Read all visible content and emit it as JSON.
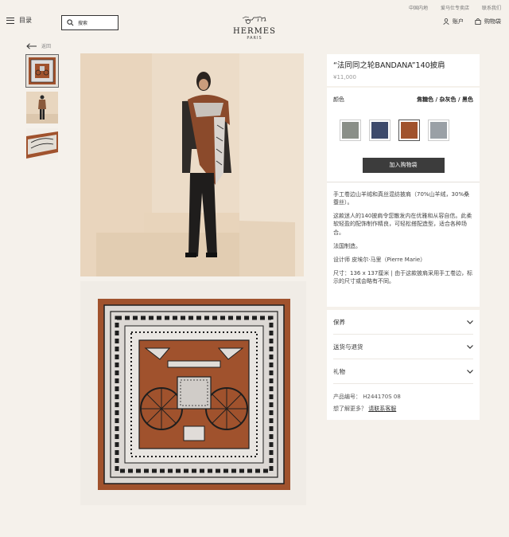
{
  "header": {
    "toplinks": [
      "中国内地",
      "爱马仕专卖店",
      "联系我们"
    ],
    "menu_label": "目录",
    "search_placeholder": "搜索",
    "brand": "HERMES",
    "city": "PARIS",
    "account_label": "账户",
    "cart_label": "购物袋"
  },
  "nav": {
    "back_label": "返回"
  },
  "product": {
    "title": "“法同同之轮BANDANA”140披肩",
    "price": "¥11,000",
    "color_label": "颜色",
    "color_values": "焦糖色 / 杂灰色 / 黑色",
    "add_to_cart": "加入购物袋",
    "description": [
      "手工卷边山羊绒和真丝混纺披肩（70%山羊绒，30%桑蚕丝）。",
      "这款迷人的140披肩令您散发内在优雅和从容自信。此柔软轻盈的配饰制作精良，可轻松搭配造型，适合各种场合。",
      "法国制造。",
      "设计师 皮埃尔·马里（Pierre Marie）",
      "尺寸：136 x 137厘米 | 由于这款披肩采用手工卷边，标示的尺寸或会略有不同。"
    ],
    "swatch_colors": [
      "#8a8f88",
      "#3d4a6b",
      "#a0522d",
      "#9aa0a6"
    ]
  },
  "accordion": {
    "items": [
      "保养",
      "送货与退货",
      "礼物"
    ]
  },
  "meta": {
    "sku_label": "产品编号：",
    "sku": "H244170S 08",
    "help_label": "想了解更多？",
    "help_link": "请联系客服"
  },
  "colors": {
    "scarf_brown": "#a0522d",
    "button_dark": "#3c3c3c",
    "page_bg": "#f5f1eb"
  }
}
